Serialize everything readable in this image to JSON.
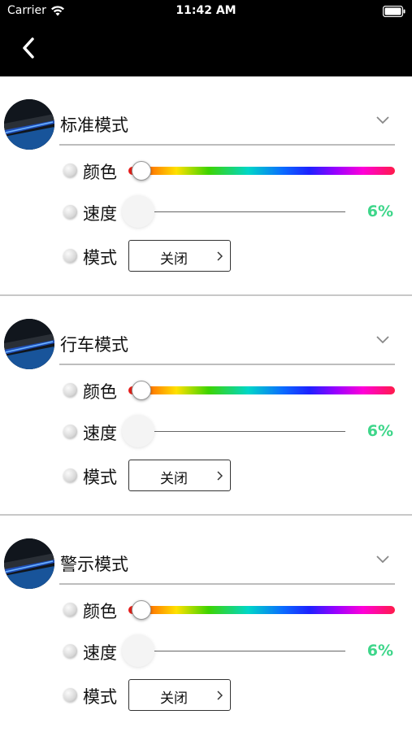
{
  "status_bar": {
    "carrier": "Carrier",
    "time": "11:42 AM"
  },
  "nav": {
    "back_icon": "chevron-left-icon"
  },
  "colors": {
    "accent_green": "#3ed68a",
    "nav_background": "#000000"
  },
  "sections": [
    {
      "title": "标准模式",
      "color_label": "颜色",
      "speed_label": "速度",
      "speed_value": "6%",
      "mode_label": "模式",
      "mode_value": "关闭"
    },
    {
      "title": "行车模式",
      "color_label": "颜色",
      "speed_label": "速度",
      "speed_value": "6%",
      "mode_label": "模式",
      "mode_value": "关闭"
    },
    {
      "title": "警示模式",
      "color_label": "颜色",
      "speed_label": "速度",
      "speed_value": "6%",
      "mode_label": "模式",
      "mode_value": "关闭"
    }
  ]
}
